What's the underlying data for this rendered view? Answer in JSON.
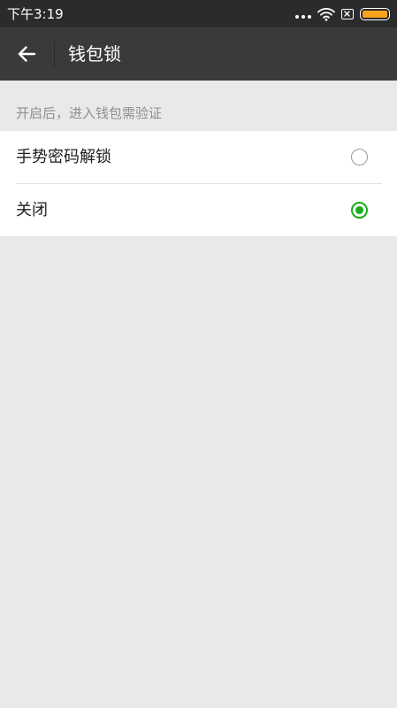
{
  "status_bar": {
    "time": "下午3:19",
    "icons": [
      "more-dots-icon",
      "wifi-icon",
      "sim-card-icon",
      "battery-icon"
    ],
    "battery_color": "#f7a21c"
  },
  "app_bar": {
    "back_icon": "arrow-left-icon",
    "title": "钱包锁"
  },
  "section": {
    "hint": "开启后，进入钱包需验证"
  },
  "options": [
    {
      "label": "手势密码解锁",
      "selected": false
    },
    {
      "label": "关闭",
      "selected": true
    }
  ],
  "colors": {
    "accent": "#1aad19",
    "app_bar_bg": "#3a3a3c",
    "status_bar_bg": "#2b2b2d",
    "page_bg": "#e9e9e9"
  }
}
